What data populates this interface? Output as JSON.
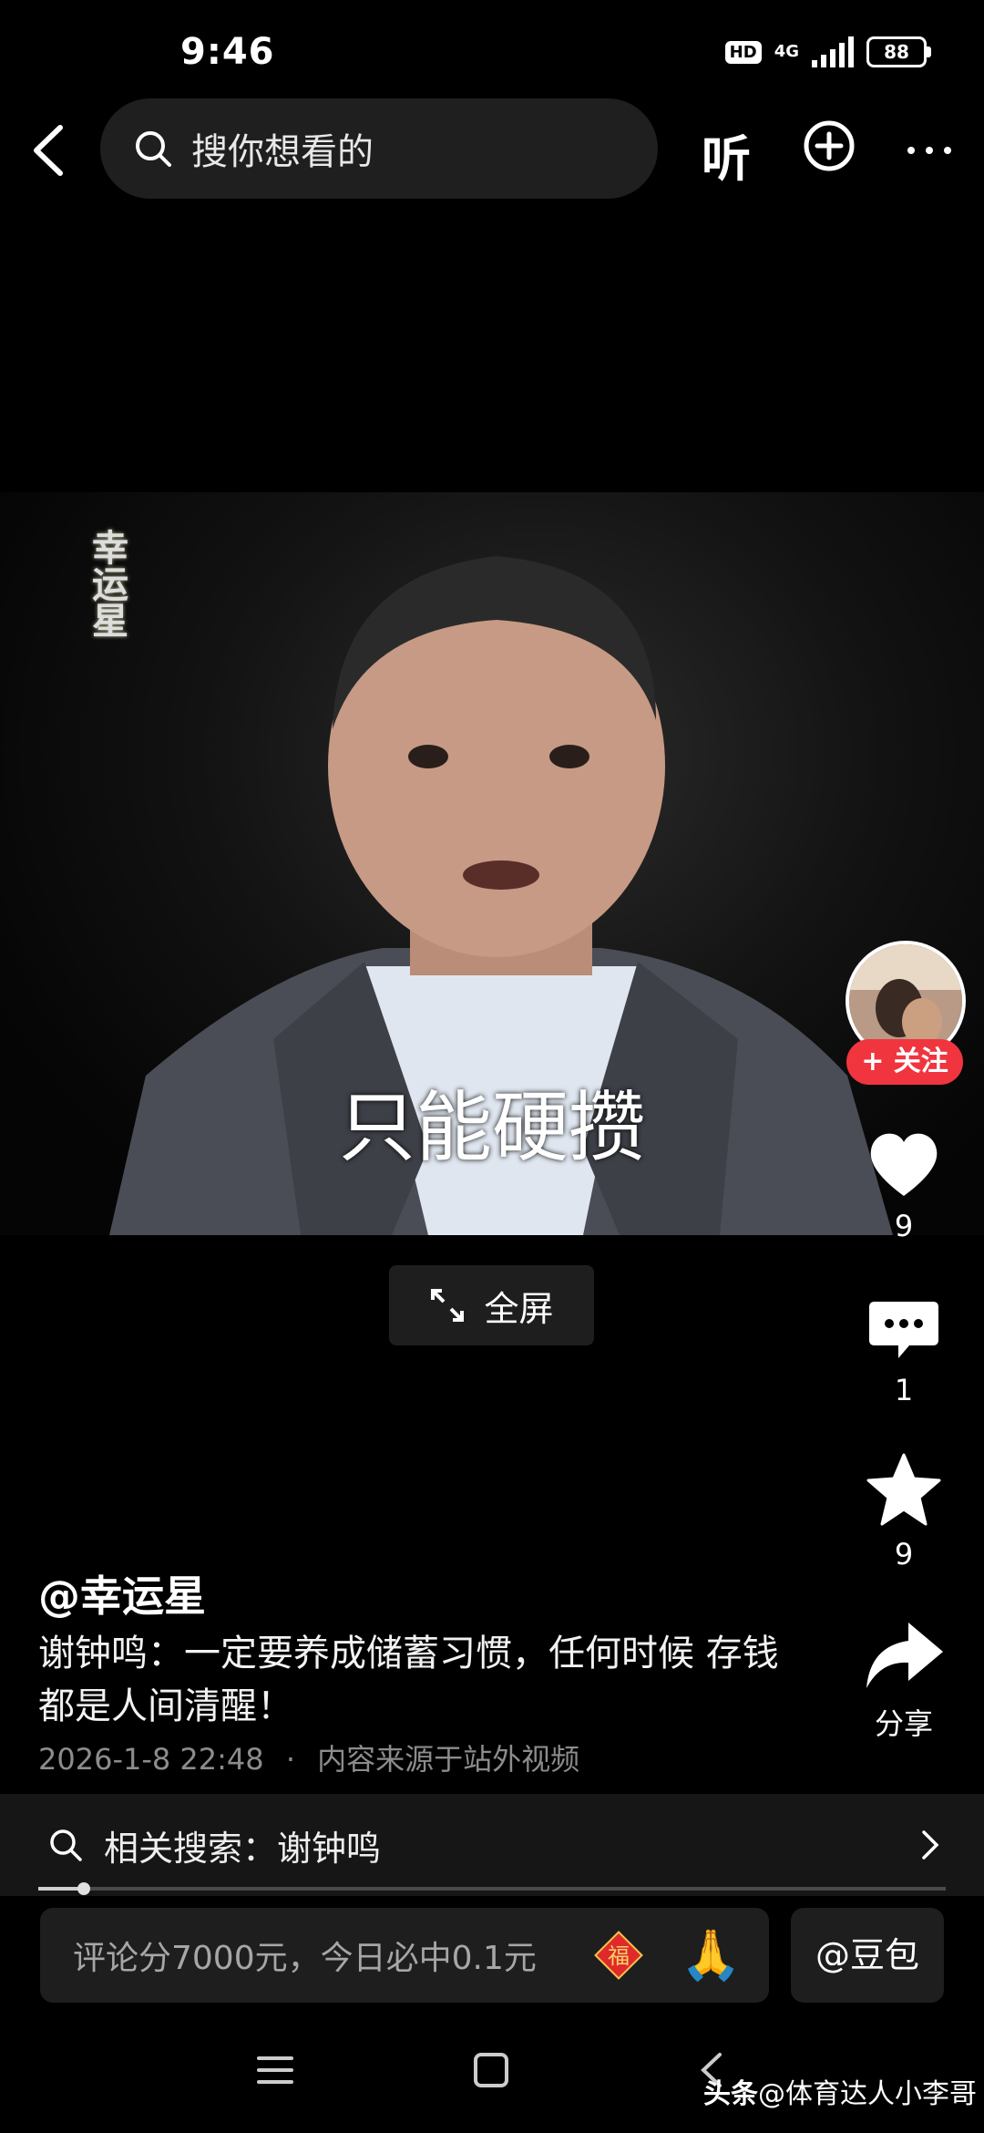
{
  "status_bar": {
    "time": "9:46",
    "hd": "HD",
    "network": "4G",
    "battery": "88"
  },
  "top_nav": {
    "back_icon": "chevron-left-icon",
    "search_placeholder": "搜你想看的",
    "listen_label": "听",
    "add_icon": "plus-circle-icon",
    "more_icon": "ellipsis-icon"
  },
  "video": {
    "watermark": "幸运星",
    "subtitle": "只能硬攒",
    "fullscreen_label": "全屏"
  },
  "right_rail": {
    "follow_label": "+ 关注",
    "like_count": "9",
    "comment_count": "1",
    "favorite_count": "9",
    "share_label": "分享"
  },
  "post": {
    "author": "@幸运星",
    "description": "谢钟鸣：一定要养成储蓄习惯，任何时候 存钱都是人间清醒！",
    "timestamp": "2026-1-8 22:48",
    "separator": "·",
    "source": "内容来源于站外视频"
  },
  "related_search": {
    "label": "相关搜索：谢钟鸣"
  },
  "playback": {
    "progress_fraction": 0.05
  },
  "bottom_bar": {
    "comment_placeholder": "评论分7000元，今日必中0.1元",
    "fu_char": "福",
    "pray_emoji": "🙏",
    "doubao_label": "@豆包"
  },
  "footer": {
    "brand": "头条",
    "handle": "@体育达人小李哥"
  },
  "colors": {
    "follow_red": "#f0353f",
    "background": "#000000"
  }
}
